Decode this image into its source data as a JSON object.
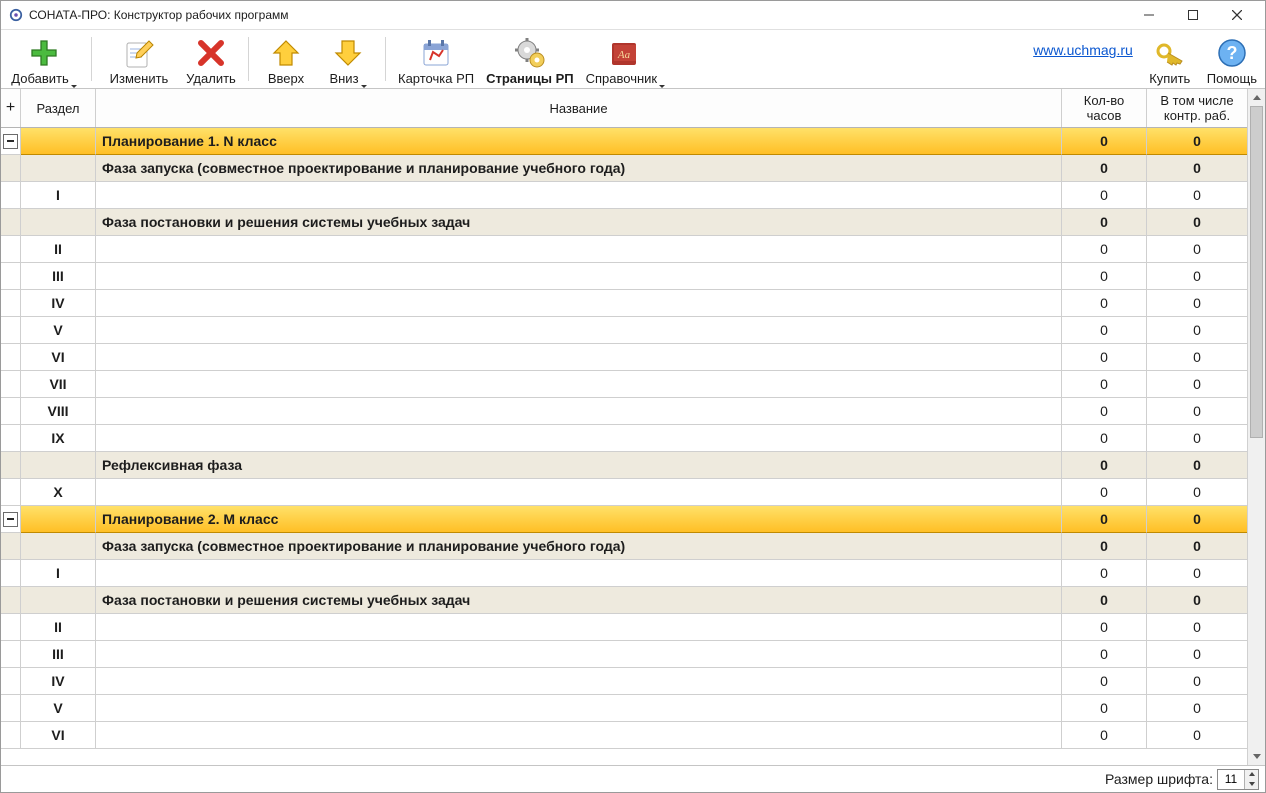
{
  "window": {
    "title": "СОНАТА-ПРО: Конструктор рабочих программ"
  },
  "toolbar": {
    "add": "Добавить",
    "edit": "Изменить",
    "delete": "Удалить",
    "up": "Вверх",
    "down": "Вниз",
    "card": "Карточка РП",
    "pages": "Страницы РП",
    "ref": "Справочник",
    "buy": "Купить",
    "help": "Помощь",
    "link": "www.uchmag.ru"
  },
  "columns": {
    "plus": "+",
    "section": "Раздел",
    "title": "Название",
    "hours": "Кол-во\nчасов",
    "ctrl": "В том числе\nконтр. раб."
  },
  "rows": [
    {
      "type": "planning",
      "title": "Планирование 1. N класс",
      "hours": "0",
      "ctrl": "0"
    },
    {
      "type": "phase",
      "title": "Фаза запуска (совместное проектирование и  планирование учебного года)",
      "hours": "0",
      "ctrl": "0"
    },
    {
      "type": "item",
      "section": "I",
      "title": "",
      "hours": "0",
      "ctrl": "0"
    },
    {
      "type": "phase",
      "title": "Фаза постановки и решения системы учебных задач",
      "hours": "0",
      "ctrl": "0"
    },
    {
      "type": "item",
      "section": "II",
      "title": "",
      "hours": "0",
      "ctrl": "0"
    },
    {
      "type": "item",
      "section": "III",
      "title": "",
      "hours": "0",
      "ctrl": "0"
    },
    {
      "type": "item",
      "section": "IV",
      "title": "",
      "hours": "0",
      "ctrl": "0"
    },
    {
      "type": "item",
      "section": "V",
      "title": "",
      "hours": "0",
      "ctrl": "0"
    },
    {
      "type": "item",
      "section": "VI",
      "title": "",
      "hours": "0",
      "ctrl": "0"
    },
    {
      "type": "item",
      "section": "VII",
      "title": "",
      "hours": "0",
      "ctrl": "0"
    },
    {
      "type": "item",
      "section": "VIII",
      "title": "",
      "hours": "0",
      "ctrl": "0"
    },
    {
      "type": "item",
      "section": "IX",
      "title": "",
      "hours": "0",
      "ctrl": "0"
    },
    {
      "type": "phase",
      "title": "Рефлексивная фаза",
      "hours": "0",
      "ctrl": "0"
    },
    {
      "type": "item",
      "section": "X",
      "title": "",
      "hours": "0",
      "ctrl": "0"
    },
    {
      "type": "planning",
      "title": "Планирование 2. M класс",
      "hours": "0",
      "ctrl": "0"
    },
    {
      "type": "phase",
      "title": "Фаза запуска (совместное проектирование и  планирование учебного года)",
      "hours": "0",
      "ctrl": "0"
    },
    {
      "type": "item",
      "section": "I",
      "title": "",
      "hours": "0",
      "ctrl": "0"
    },
    {
      "type": "phase",
      "title": "Фаза постановки и решения системы учебных задач",
      "hours": "0",
      "ctrl": "0"
    },
    {
      "type": "item",
      "section": "II",
      "title": "",
      "hours": "0",
      "ctrl": "0"
    },
    {
      "type": "item",
      "section": "III",
      "title": "",
      "hours": "0",
      "ctrl": "0"
    },
    {
      "type": "item",
      "section": "IV",
      "title": "",
      "hours": "0",
      "ctrl": "0"
    },
    {
      "type": "item",
      "section": "V",
      "title": "",
      "hours": "0",
      "ctrl": "0"
    },
    {
      "type": "item",
      "section": "VI",
      "title": "",
      "hours": "0",
      "ctrl": "0"
    }
  ],
  "status": {
    "fontLabel": "Размер шрифта:",
    "fontSize": "11"
  }
}
